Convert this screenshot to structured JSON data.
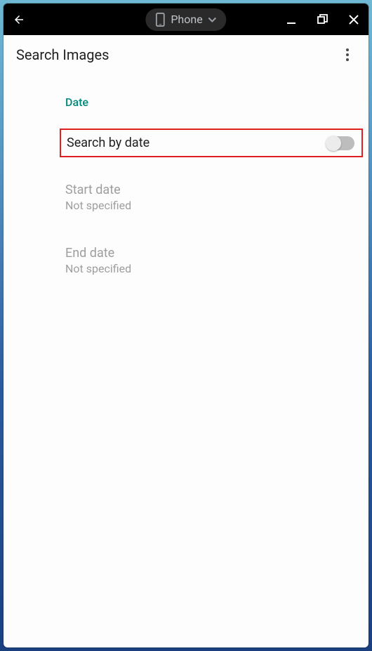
{
  "titlebar": {
    "device_label": "Phone"
  },
  "header": {
    "title": "Search Images"
  },
  "date_section": {
    "label": "Date",
    "toggle_label": "Search by date",
    "toggle_on": false,
    "start": {
      "title": "Start date",
      "value": "Not specified"
    },
    "end": {
      "title": "End date",
      "value": "Not specified"
    }
  }
}
